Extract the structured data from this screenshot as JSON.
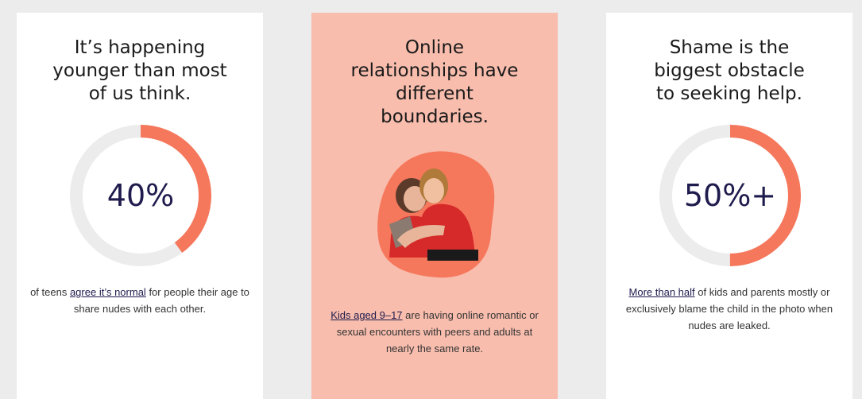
{
  "cards": [
    {
      "heading": "It’s happening\nyounger than most\nof us think.",
      "stat": "40%",
      "progress_percent": 40,
      "text_before": "of teens ",
      "link": "agree it’s normal",
      "text_after": " for people their age to share nudes with each other."
    },
    {
      "heading": "Online\nrelationships have\ndifferent\nboundaries.",
      "link": "Kids aged 9–17",
      "text_after": " are having online romantic or sexual encounters with peers and adults at nearly the same rate."
    },
    {
      "heading": "Shame is the\nbiggest obstacle\nto seeking help.",
      "stat": "50%+",
      "progress_percent": 50,
      "link": "More than half",
      "text_after": " of kids and parents mostly or exclusively blame the child in the photo when nudes are leaked."
    }
  ],
  "colors": {
    "accent": "#f6785c",
    "ring_track": "#ececec",
    "middle_card": "#f8bdad",
    "stat_text": "#1f1b4d"
  },
  "icons": [
    "teens-selfie-photo"
  ]
}
